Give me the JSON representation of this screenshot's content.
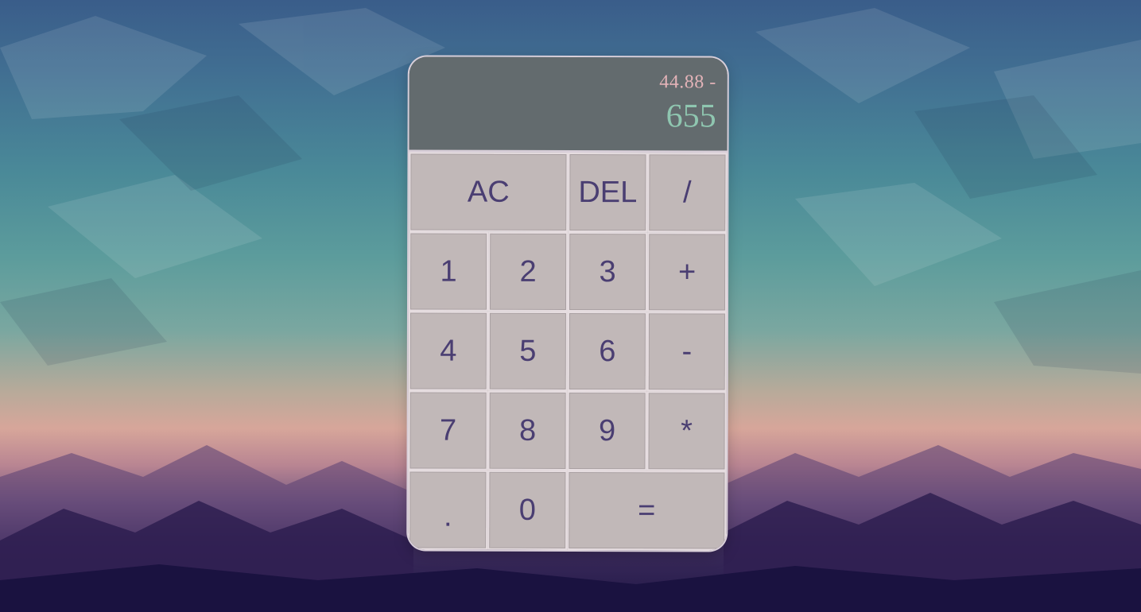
{
  "display": {
    "previous_operand": "44.88 -",
    "current_operand": "655"
  },
  "keys": {
    "all_clear": "AC",
    "delete": "DEL",
    "divide": "/",
    "one": "1",
    "two": "2",
    "three": "3",
    "add": "+",
    "four": "4",
    "five": "5",
    "six": "6",
    "subtract": "-",
    "seven": "7",
    "eight": "8",
    "nine": "9",
    "multiply": "*",
    "decimal": ".",
    "zero": "0",
    "equals": "="
  },
  "colors": {
    "display_bg": "#636b6e",
    "previous_text": "#e3b3b8",
    "current_text": "#8fc6b0",
    "key_bg": "#c1b8b8",
    "key_text": "#4a3e72",
    "key_border": "#e6dde0"
  }
}
